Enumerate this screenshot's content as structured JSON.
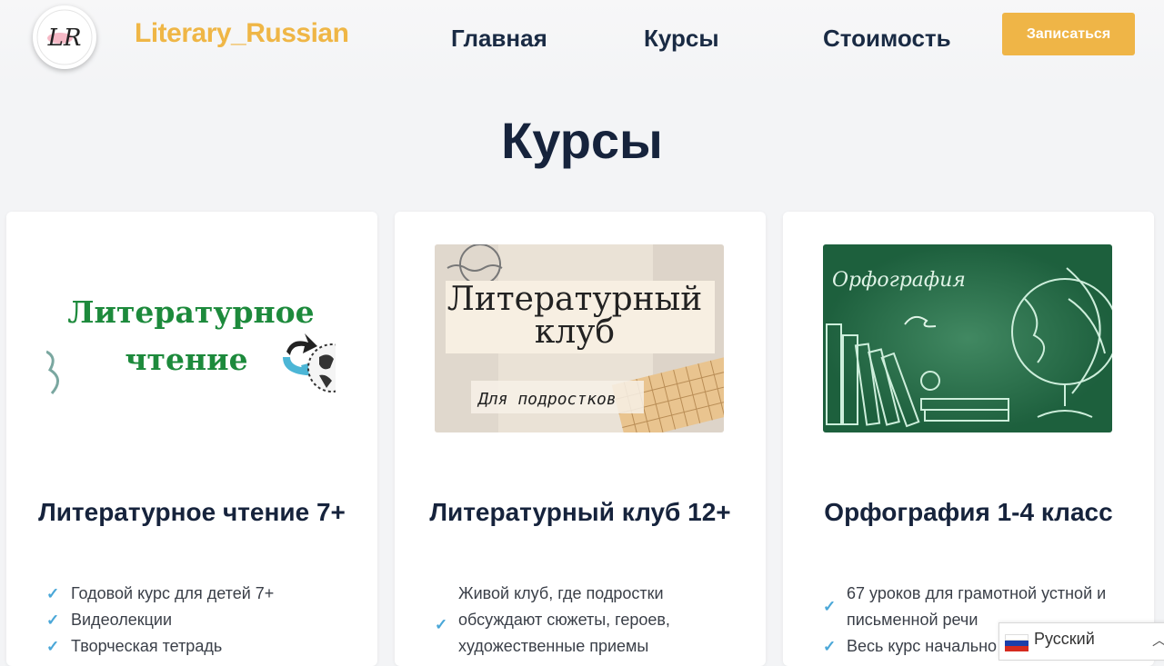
{
  "header": {
    "logo_text": "LR",
    "brand": "Literary_Russian",
    "nav": [
      "Главная",
      "Курсы",
      "Стоимость"
    ],
    "cta": "Записаться"
  },
  "page_title": "Курсы",
  "cards": [
    {
      "image_text": [
        "Литературное",
        "чтение"
      ],
      "title": "Литературное чтение 7+",
      "features": [
        "Годовой курс для детей 7+",
        "Видеолекции",
        "Творческая тетрадь"
      ]
    },
    {
      "image_text": [
        "Литературный",
        "клуб",
        "Для подростков"
      ],
      "title": "Литературный клуб 12+",
      "features": [
        "Живой клуб, где подростки обсуждают сюжеты, героев, художественные приемы"
      ]
    },
    {
      "image_text": [
        "Орфография"
      ],
      "title": "Орфография 1-4 класс",
      "features": [
        "67 уроков для грамотной устной и письменной речи",
        "Весь курс начально"
      ]
    }
  ],
  "lang": {
    "label": "Русский",
    "flag_colors": [
      "#ffffff",
      "#1c3faa",
      "#d52b1e"
    ]
  },
  "colors": {
    "accent": "#efb547",
    "heading": "#16233c",
    "check": "#4aa7d8"
  }
}
